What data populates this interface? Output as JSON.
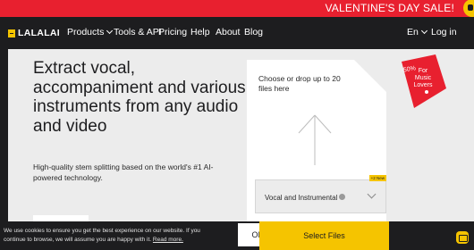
{
  "promo": {
    "text": "VALENTINE'S DAY SALE!"
  },
  "nav": {
    "logo": "LALALAI",
    "items": [
      {
        "label": "Products",
        "has_chevron": true
      },
      {
        "label": "Tools & API"
      },
      {
        "label": "Pricing"
      },
      {
        "label": "Help"
      },
      {
        "label": "About"
      },
      {
        "label": "Blog"
      }
    ],
    "language": "En",
    "login": "Log in"
  },
  "hero": {
    "title": "Extract vocal, accompaniment and various instruments from any audio and video",
    "subtitle": "High-quality stem splitting based on the world's #1 AI-powered technology."
  },
  "upload": {
    "drop_text": "Choose or drop up to 20 files here",
    "stem_select": {
      "value": "Vocal and Instrumental",
      "badge": "+2 New"
    },
    "select_button": "Select Files"
  },
  "promo_badge": {
    "discount": "-50%",
    "line1": "For",
    "line2": "Music",
    "line3": "Lovers"
  },
  "cookie": {
    "text": "We use cookies to ensure you get the best experience on our website. If you continue to browse, we will assume you are happy with it.",
    "link": "Read more.",
    "ok": "OK"
  },
  "colors": {
    "accent_yellow": "#f5c400",
    "promo_red": "#e8202f",
    "dark_bg": "#1d1d1f",
    "card_bg": "#ececec"
  }
}
